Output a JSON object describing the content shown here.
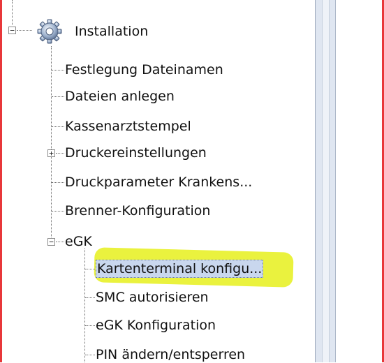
{
  "tree": {
    "root": {
      "label": "Installation",
      "expanded": true,
      "icon": "gear-icon",
      "expander_symbol": "−"
    },
    "children": [
      {
        "label": "Festlegung Dateinamen"
      },
      {
        "label": "Dateien anlegen"
      },
      {
        "label": "Kassenarztstempel"
      },
      {
        "label": "Druckereinstellungen",
        "expander_symbol": "+"
      },
      {
        "label": "Druckparameter Krankens..."
      },
      {
        "label": "Brenner-Konfiguration"
      },
      {
        "label": "eGK",
        "expander_symbol": "−"
      }
    ],
    "egk_children": [
      {
        "label": "Kartenterminal konfigu...",
        "selected": true,
        "highlighted": true
      },
      {
        "label": "SMC autorisieren"
      },
      {
        "label": "eGK Konfiguration"
      },
      {
        "label": "PIN ändern/entsperren"
      }
    ]
  },
  "colors": {
    "frame_border": "#e8373a",
    "selection_bg": "#c9d7ee",
    "highlighter": "#e6f01c",
    "splitter": "#dfe6f1"
  }
}
